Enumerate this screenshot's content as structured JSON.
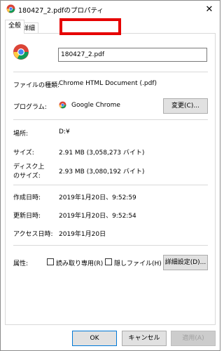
{
  "window": {
    "title": "180427_2.pdfのプロパティ",
    "close_glyph": "✕"
  },
  "tabs": [
    {
      "label": "全般"
    },
    {
      "label": "詳細"
    }
  ],
  "general": {
    "file_name": "180427_2.pdf",
    "file_type_label": "ファイルの種類:",
    "file_type_value": "Chrome HTML Document (.pdf)",
    "program_label": "プログラム:",
    "program_value": "Google Chrome",
    "change_button": "変更(C)...",
    "location_label": "場所:",
    "location_value": "D:¥",
    "size_label": "サイズ:",
    "size_value": "2.91 MB (3,058,273 バイト)",
    "disk_size_label_1": "ディスク上",
    "disk_size_label_2": "のサイズ:",
    "disk_size_value": "2.93 MB (3,080,192 バイト)",
    "created_label": "作成日時:",
    "created_value": "2019年1月20日、9:52:59",
    "modified_label": "更新日時:",
    "modified_value": "2019年1月20日、9:52:54",
    "accessed_label": "アクセス日時:",
    "accessed_value": "2019年1月20日",
    "attributes_label": "属性:",
    "readonly_label": "読み取り専用(R)",
    "hidden_label": "隠しファイル(H)",
    "advanced_button": "詳細設定(D)..."
  },
  "footer": {
    "ok": "OK",
    "cancel": "キャンセル",
    "apply": "適用(A)"
  },
  "colors": {
    "annotation": "#e60000",
    "ok_border": "#0078d7"
  },
  "icons": {
    "title": "chrome-icon",
    "file": "chrome-icon",
    "program": "chrome-icon"
  }
}
